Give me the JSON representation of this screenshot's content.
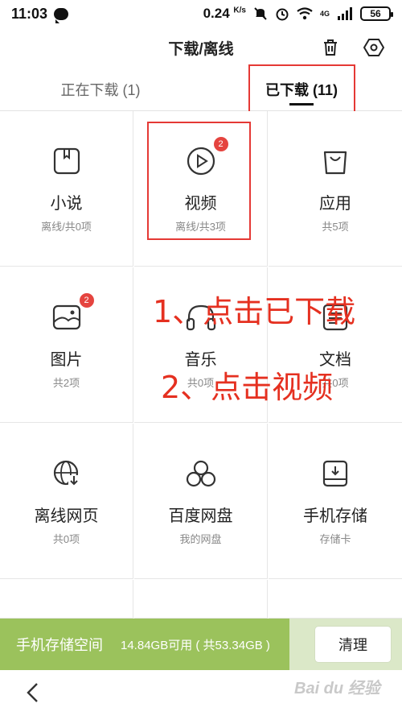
{
  "status_bar": {
    "time": "11:03",
    "speed": "0.24",
    "speed_unit": "K/s",
    "network": "4G",
    "battery": "56"
  },
  "header": {
    "title": "下载/离线",
    "delete_icon": "trash-icon",
    "settings_icon": "hexagon-settings-icon"
  },
  "tabs": [
    {
      "label": "正在下载 (1)",
      "active": false
    },
    {
      "label": "已下载 (11)",
      "active": true
    }
  ],
  "categories": [
    {
      "title": "小说",
      "subtitle": "离线/共0项",
      "icon": "book-icon"
    },
    {
      "title": "视频",
      "subtitle": "离线/共3项",
      "icon": "play-icon",
      "badge": "2"
    },
    {
      "title": "应用",
      "subtitle": "共5项",
      "icon": "shopping-bag-icon"
    },
    {
      "title": "图片",
      "subtitle": "共2项",
      "icon": "image-icon",
      "badge": "2"
    },
    {
      "title": "音乐",
      "subtitle": "共0项",
      "icon": "headphones-icon"
    },
    {
      "title": "文档",
      "subtitle": "共0项",
      "icon": "document-icon"
    },
    {
      "title": "离线网页",
      "subtitle": "共0项",
      "icon": "globe-download-icon"
    },
    {
      "title": "百度网盘",
      "subtitle": "我的网盘",
      "icon": "cloud-disk-icon"
    },
    {
      "title": "手机存储",
      "subtitle": "存储卡",
      "icon": "storage-icon"
    }
  ],
  "annotations": [
    "1、点击已下载",
    "2、点击视频"
  ],
  "storage": {
    "title": "手机存储空间",
    "detail": "14.84GB可用 ( 共53.34GB )",
    "clean_label": "清理"
  },
  "watermark": "Bai du 经验",
  "colors": {
    "accent_green": "#9bc25c",
    "badge_red": "#e5443f",
    "annotation_red": "#e53020"
  }
}
